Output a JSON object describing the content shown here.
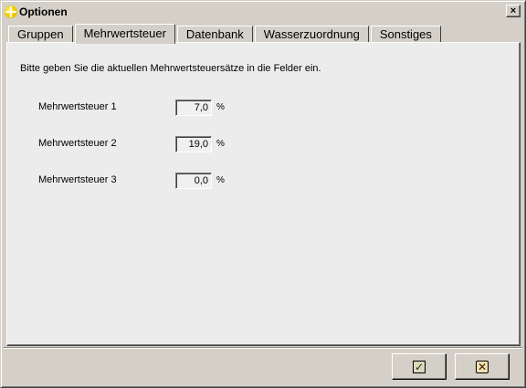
{
  "window": {
    "title": "Optionen",
    "close_symbol": "×",
    "icon": "app-icon"
  },
  "tabs": [
    {
      "label": "Gruppen"
    },
    {
      "label": "Mehrwertsteuer",
      "active": true
    },
    {
      "label": "Datenbank"
    },
    {
      "label": "Wasserzuordnung"
    },
    {
      "label": "Sonstiges"
    }
  ],
  "panel": {
    "instruction": "Bitte geben Sie die aktuellen Mehrwertsteuersätze in die Felder ein.",
    "rows": [
      {
        "label": "Mehrwertsteuer 1",
        "value": "7,0",
        "unit": "%"
      },
      {
        "label": "Mehrwertsteuer 2",
        "value": "19,0",
        "unit": "%"
      },
      {
        "label": "Mehrwertsteuer 3",
        "value": "0,0",
        "unit": "%"
      }
    ]
  },
  "buttons": {
    "ok_symbol": "✓",
    "cancel_symbol": "✕"
  }
}
